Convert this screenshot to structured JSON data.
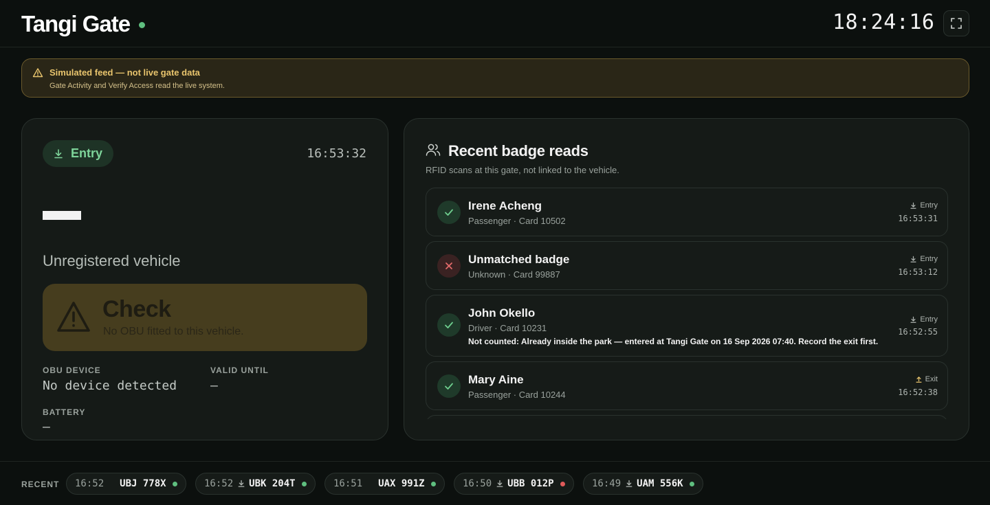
{
  "header": {
    "title": "Tangi Gate",
    "clock": "18:24:16"
  },
  "banner": {
    "title": "Simulated feed — not live gate data",
    "subtitle": "Gate Activity and Verify Access read the live system."
  },
  "vehicle": {
    "direction": "Entry",
    "event_time": "16:53:32",
    "status": "Unregistered vehicle",
    "check_title": "Check",
    "check_message": "No OBU fitted to this vehicle.",
    "obu_label": "OBU DEVICE",
    "obu_value": "No device detected",
    "valid_label": "VALID UNTIL",
    "valid_value": "—",
    "battery_label": "BATTERY",
    "battery_value": "—"
  },
  "badge_reads": {
    "title": "Recent badge reads",
    "subtitle": "RFID scans at this gate, not linked to the vehicle.",
    "items": [
      {
        "name": "Irene Acheng",
        "meta": "Passenger · Card 10502",
        "direction": "Entry",
        "time": "16:53:31",
        "ok": true
      },
      {
        "name": "Unmatched badge",
        "meta": "Unknown · Card 99887",
        "direction": "Entry",
        "time": "16:53:12",
        "ok": false
      },
      {
        "name": "John Okello",
        "meta": "Driver · Card 10231",
        "note": "Not counted: Already inside the park — entered at Tangi Gate on 16 Sep 2026 07:40. Record the exit first.",
        "direction": "Entry",
        "time": "16:52:55",
        "ok": true
      },
      {
        "name": "Mary Aine",
        "meta": "Passenger · Card 10244",
        "direction": "Exit",
        "time": "16:52:38",
        "ok": true
      }
    ]
  },
  "recent": {
    "label": "RECENT",
    "chips": [
      {
        "time": "16:52",
        "plate": "UBJ 778X",
        "icon": "",
        "dot": "#5fbf7f"
      },
      {
        "time": "16:52",
        "plate": "UBK 204T",
        "icon": "entry-icon",
        "dot": "#5fbf7f"
      },
      {
        "time": "16:51",
        "plate": "UAX 991Z",
        "icon": "",
        "dot": "#5fbf7f"
      },
      {
        "time": "16:50",
        "plate": "UBB 012P",
        "icon": "entry-icon",
        "dot": "#e05a5a"
      },
      {
        "time": "16:49",
        "plate": "UAM 556K",
        "icon": "entry-icon",
        "dot": "#5fbf7f"
      }
    ]
  },
  "colors": {
    "accent_green": "#5fbf7f",
    "warn_amber": "#e8c46d",
    "alert_red": "#e05a5a"
  }
}
